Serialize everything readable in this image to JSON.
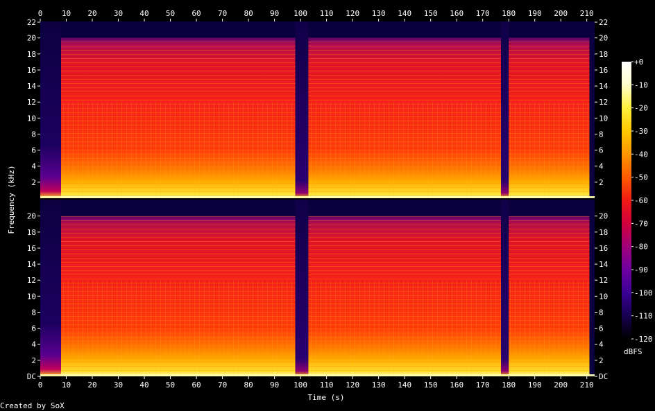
{
  "chart_data": {
    "type": "heatmap",
    "title": "",
    "xlabel": "Time (s)",
    "ylabel": "Frequency (kHz)",
    "x_ticks": [
      "0",
      "10",
      "20",
      "30",
      "40",
      "50",
      "60",
      "70",
      "80",
      "90",
      "100",
      "110",
      "120",
      "130",
      "140",
      "150",
      "160",
      "170",
      "180",
      "190",
      "200",
      "210"
    ],
    "xlim": [
      0,
      213
    ],
    "channels": [
      {
        "name": "",
        "y_ticks": [
          "22",
          "20",
          "18",
          "16",
          "14",
          "12",
          "10",
          "8",
          "6",
          "4",
          "2"
        ],
        "ylim_khz": [
          0,
          22.05
        ]
      },
      {
        "name": "",
        "y_ticks": [
          "DC",
          "2",
          "4",
          "6",
          "8",
          "10",
          "12",
          "14",
          "16",
          "18",
          "20"
        ],
        "ylim_khz": [
          0,
          22.05
        ]
      }
    ],
    "colorbar": {
      "label": "dBFS",
      "ticks": [
        "+0",
        "-10",
        "-20",
        "-30",
        "-40",
        "-50",
        "-60",
        "-70",
        "-80",
        "-90",
        "-100",
        "-110",
        "-120"
      ],
      "range_db": [
        -120,
        0
      ],
      "colors": [
        "#000000",
        "#160050",
        "#3c0096",
        "#6e00a0",
        "#a0007a",
        "#d2003c",
        "#f01a14",
        "#ff5a00",
        "#ff9600",
        "#ffc800",
        "#fff03c",
        "#ffffcc",
        "#ffffff"
      ]
    },
    "segments_s": [
      {
        "start": 0,
        "end": 8,
        "level": "quiet intro, low-frequency energy only"
      },
      {
        "start": 8,
        "end": 98,
        "level": "loud, energy up to 20 kHz"
      },
      {
        "start": 98,
        "end": 103,
        "level": "near silence"
      },
      {
        "start": 103,
        "end": 177,
        "level": "loud, energy up to 20 kHz"
      },
      {
        "start": 177,
        "end": 180,
        "level": "near silence"
      },
      {
        "start": 180,
        "end": 211,
        "level": "loud, energy up to 20 kHz"
      }
    ],
    "lowpass_cutoff_khz": 20,
    "footer": "Created by SoX"
  }
}
